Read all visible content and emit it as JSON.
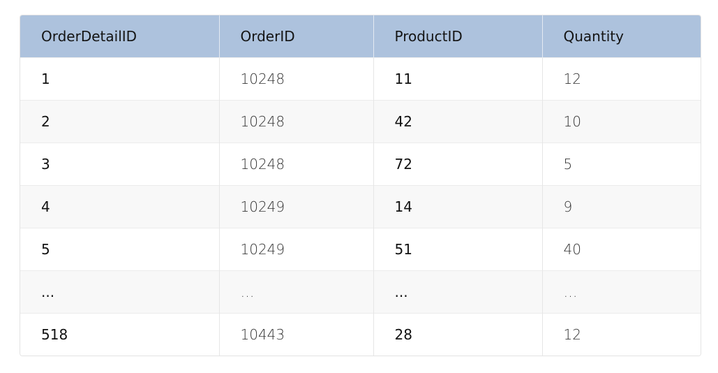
{
  "table": {
    "headers": [
      "OrderDetailID",
      "OrderID",
      "ProductID",
      "Quantity"
    ],
    "rows": [
      [
        "1",
        "10248",
        "11",
        "12"
      ],
      [
        "2",
        "10248",
        "42",
        "10"
      ],
      [
        "3",
        "10248",
        "72",
        "5"
      ],
      [
        "4",
        "10249",
        "14",
        "9"
      ],
      [
        "5",
        "10249",
        "51",
        "40"
      ],
      [
        "...",
        "…",
        "...",
        "…"
      ],
      [
        "518",
        "10443",
        "28",
        "12"
      ]
    ]
  },
  "colors": {
    "header_bg": "#adc2dd",
    "zebra_bg": "#f8f8f8",
    "border": "#e3e3e3"
  }
}
